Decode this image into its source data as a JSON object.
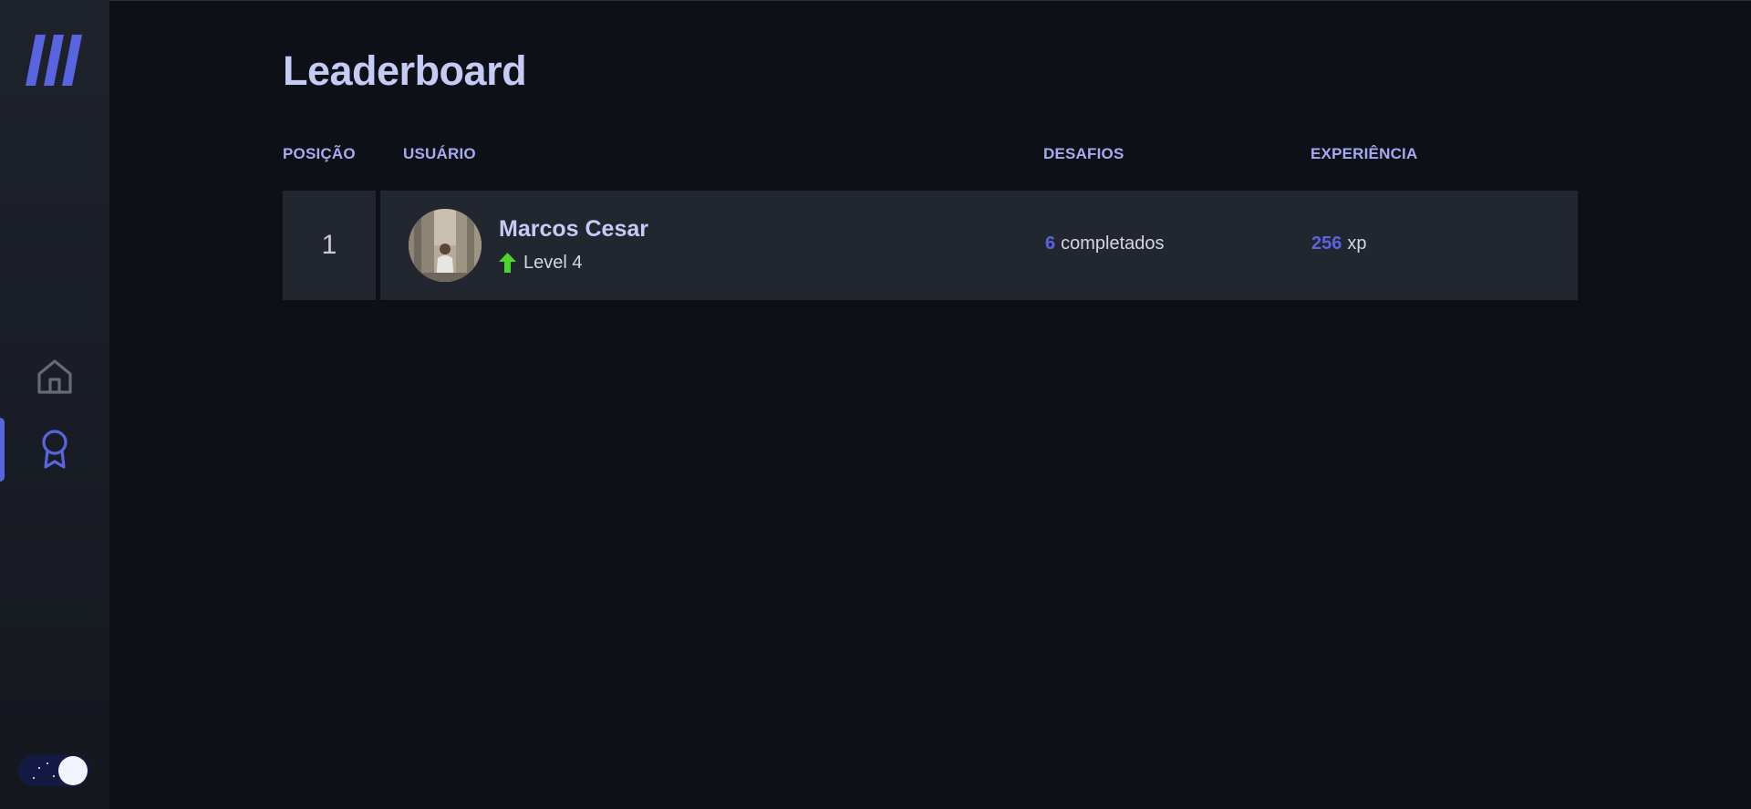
{
  "sidebar": {
    "nav": [
      {
        "name": "home",
        "icon": "home-icon",
        "active": false
      },
      {
        "name": "leaderboard",
        "icon": "award-icon",
        "active": true
      }
    ],
    "theme_toggle": {
      "mode": "dark",
      "icon": "moon-icon"
    }
  },
  "colors": {
    "accent": "#5965e0",
    "title": "#c4cbf5",
    "header": "#a4abf0",
    "level_up": "#4cd62b",
    "background": "#0d1017",
    "card": "#22262f"
  },
  "page": {
    "title": "Leaderboard",
    "columns": {
      "position": "POSIÇÃO",
      "user": "USUÁRIO",
      "challenges": "DESAFIOS",
      "experience": "EXPERIÊNCIA"
    }
  },
  "rows": [
    {
      "position": "1",
      "name": "Marcos Cesar",
      "level_icon": "level-up-arrow-icon",
      "level": "Level 4",
      "challenges_count": "6",
      "challenges_label": "completados",
      "xp_count": "256",
      "xp_label": "xp"
    }
  ]
}
